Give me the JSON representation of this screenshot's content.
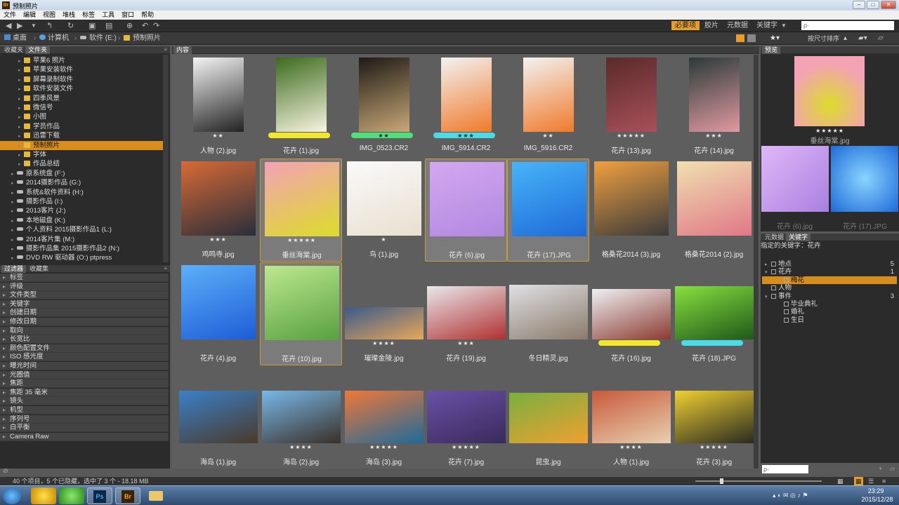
{
  "window": {
    "title": "预制照片"
  },
  "menu": [
    "文件",
    "编辑",
    "视图",
    "堆栈",
    "标签",
    "工具",
    "窗口",
    "帮助"
  ],
  "workspaces": {
    "active": "必要项",
    "items": [
      "胶片",
      "元数据",
      "关键字"
    ]
  },
  "search": {
    "placeholder": "ρ·"
  },
  "path": [
    "桌面",
    "计算机",
    "软件 (E:)",
    "预制照片"
  ],
  "sort": {
    "label": "按尺寸排序"
  },
  "panels": {
    "favorites": "收藏夹",
    "folders": "文件夹",
    "filter": "过滤器",
    "collections": "收藏集",
    "content": "内容",
    "preview": "预览",
    "metadata": "元数据",
    "keywords": "关键字"
  },
  "folders": [
    {
      "name": "苹果6 照片",
      "type": "folder",
      "indent": 1
    },
    {
      "name": "苹果安装软件",
      "type": "folder",
      "indent": 1
    },
    {
      "name": "屏幕录制软件",
      "type": "folder",
      "indent": 1
    },
    {
      "name": "软件安装文件",
      "type": "folder",
      "indent": 1
    },
    {
      "name": "四季风景",
      "type": "folder",
      "indent": 1
    },
    {
      "name": "微信号",
      "type": "folder",
      "indent": 1
    },
    {
      "name": "小图",
      "type": "folder",
      "indent": 1
    },
    {
      "name": "学员作品",
      "type": "folder",
      "indent": 1
    },
    {
      "name": "迅雷下载",
      "type": "folder",
      "indent": 1
    },
    {
      "name": "预制照片",
      "type": "folder",
      "indent": 1,
      "selected": true
    },
    {
      "name": "字体",
      "type": "folder",
      "indent": 1
    },
    {
      "name": "作品总结",
      "type": "folder",
      "indent": 1
    },
    {
      "name": "原系统盘 (F:)",
      "type": "drive",
      "indent": 0
    },
    {
      "name": "2014摄影作品 (G:)",
      "type": "drive",
      "indent": 0
    },
    {
      "name": "系统&软件资料 (H:)",
      "type": "drive",
      "indent": 0
    },
    {
      "name": "摄影作品 (I:)",
      "type": "drive",
      "indent": 0
    },
    {
      "name": "2013客片 (J:)",
      "type": "drive",
      "indent": 0
    },
    {
      "name": "本地磁盘 (K:)",
      "type": "drive",
      "indent": 0
    },
    {
      "name": "个人资料 2015摄影作品1 (L:)",
      "type": "drive",
      "indent": 0
    },
    {
      "name": "2014客片集 (M:)",
      "type": "drive",
      "indent": 0
    },
    {
      "name": "摄影作品集 2015摄影作品2 (N:)",
      "type": "drive",
      "indent": 0
    },
    {
      "name": "DVD RW 驱动器 (O:) ptpress",
      "type": "drive",
      "indent": 0
    }
  ],
  "filters": [
    "标签",
    "评级",
    "文件类型",
    "关键字",
    "创建日期",
    "修改日期",
    "取向",
    "长宽比",
    "颜色配置文件",
    "ISO 感光度",
    "曝光时间",
    "光圈值",
    "焦距",
    "焦距 35 毫米",
    "镜头",
    "机型",
    "序列号",
    "白平衡",
    "Camera Raw"
  ],
  "thumbnails": [
    {
      "name": "人物 (2).jpg",
      "stars": "★★",
      "row": 0,
      "col": 0,
      "w": 72,
      "h": 106,
      "colors": [
        "#f4f4f4",
        "#222"
      ]
    },
    {
      "name": "花卉 (1).jpg",
      "stars": "",
      "bar": "#f4e629",
      "row": 0,
      "col": 1,
      "w": 72,
      "h": 106,
      "colors": [
        "#3b6b1e",
        "#f8f4e0"
      ]
    },
    {
      "name": "IMG_0523.CR2",
      "stars": "★★",
      "bar": "#4ee07a",
      "row": 0,
      "col": 2,
      "w": 72,
      "h": 106,
      "colors": [
        "#1e1a15",
        "#c8a878"
      ]
    },
    {
      "name": "IMG_5914.CR2",
      "stars": "★★★",
      "bar": "#49dbe8",
      "row": 0,
      "col": 3,
      "w": 72,
      "h": 106,
      "colors": [
        "#f2f2f2",
        "#f07a2a"
      ]
    },
    {
      "name": "IMG_5916.CR2",
      "stars": "★★",
      "row": 0,
      "col": 4,
      "w": 72,
      "h": 106,
      "colors": [
        "#f2f2f2",
        "#f07a2a"
      ]
    },
    {
      "name": "花卉 (13).jpg",
      "stars": "★★★★★",
      "row": 0,
      "col": 5,
      "w": 72,
      "h": 106,
      "colors": [
        "#5a2a2a",
        "#a8505a"
      ]
    },
    {
      "name": "花卉 (14).jpg",
      "stars": "★★★",
      "row": 0,
      "col": 6,
      "w": 72,
      "h": 106,
      "colors": [
        "#2b3a3a",
        "#e09aa0"
      ]
    },
    {
      "name": "鸡鸣寺.jpg",
      "stars": "★★★",
      "row": 1,
      "col": 0,
      "w": 106,
      "h": 106,
      "colors": [
        "#d86a36",
        "#2a2e3a"
      ]
    },
    {
      "name": "垂丝海棠.jpg",
      "stars": "★★★★★",
      "row": 1,
      "col": 1,
      "w": 106,
      "h": 106,
      "colors": [
        "#f4a2b4",
        "#dcdc2a"
      ],
      "selected": true
    },
    {
      "name": "鸟 (1).jpg",
      "stars": "★",
      "row": 1,
      "col": 2,
      "w": 106,
      "h": 106,
      "colors": [
        "#fafafa",
        "#e8e0d0"
      ]
    },
    {
      "name": "花卉 (6).jpg",
      "stars": "",
      "row": 1,
      "col": 3,
      "w": 106,
      "h": 106,
      "colors": [
        "#d4a8f0",
        "#b088e0"
      ],
      "selected": true
    },
    {
      "name": "花卉 (17).JPG",
      "stars": "",
      "row": 1,
      "col": 4,
      "w": 106,
      "h": 106,
      "colors": [
        "#47b4f8",
        "#1e6ad8"
      ],
      "selected": true
    },
    {
      "name": "格桑花2014 (3).jpg",
      "stars": "",
      "row": 1,
      "col": 5,
      "w": 106,
      "h": 106,
      "colors": [
        "#f0a040",
        "#3a3a3a"
      ]
    },
    {
      "name": "格桑花2014 (2).jpg",
      "stars": "",
      "row": 1,
      "col": 6,
      "w": 106,
      "h": 106,
      "colors": [
        "#f0e0b0",
        "#e07888"
      ]
    },
    {
      "name": "花卉 (4).jpg",
      "stars": "",
      "row": 2,
      "col": 0,
      "w": 106,
      "h": 106,
      "colors": [
        "#5cb0f8",
        "#1e5cd8"
      ]
    },
    {
      "name": "花卉 (10).jpg",
      "stars": "",
      "row": 2,
      "col": 1,
      "w": 106,
      "h": 106,
      "colors": [
        "#bde890",
        "#58a040"
      ],
      "selected": true
    },
    {
      "name": "璀璨金陵.jpg",
      "stars": "★★★★",
      "row": 2,
      "col": 2,
      "w": 112,
      "h": 46,
      "colors": [
        "#3a5a8a",
        "#e8a85a"
      ]
    },
    {
      "name": "花卉 (19).jpg",
      "stars": "★★★",
      "row": 2,
      "col": 3,
      "w": 112,
      "h": 76,
      "colors": [
        "#e8e8ec",
        "#b03030"
      ]
    },
    {
      "name": "冬日精灵.jpg",
      "stars": "",
      "row": 2,
      "col": 4,
      "w": 112,
      "h": 78,
      "colors": [
        "#e0e0e4",
        "#8a7a6a"
      ]
    },
    {
      "name": "花卉 (16).jpg",
      "stars": "",
      "bar": "#f4e629",
      "row": 2,
      "col": 5,
      "w": 112,
      "h": 72,
      "colors": [
        "#f0f0f4",
        "#8a3a30"
      ]
    },
    {
      "name": "花卉 (18).JPG",
      "stars": "",
      "bar": "#49dbe8",
      "row": 2,
      "col": 6,
      "w": 112,
      "h": 76,
      "colors": [
        "#88e040",
        "#1e5818"
      ]
    },
    {
      "name": "海岛 (1).jpg",
      "stars": "",
      "row": 3,
      "col": 0,
      "w": 112,
      "h": 75,
      "colors": [
        "#3a80c8",
        "#4a3a2a"
      ]
    },
    {
      "name": "海岛 (2).jpg",
      "stars": "★★★★",
      "row": 3,
      "col": 1,
      "w": 112,
      "h": 75,
      "colors": [
        "#78b8e8",
        "#3a3028"
      ]
    },
    {
      "name": "海岛 (3).jpg",
      "stars": "★★★★★",
      "row": 3,
      "col": 2,
      "w": 112,
      "h": 75,
      "colors": [
        "#f07838",
        "#1e6a9a"
      ]
    },
    {
      "name": "花卉 (7).jpg",
      "stars": "★★★★★",
      "row": 3,
      "col": 3,
      "w": 112,
      "h": 75,
      "colors": [
        "#6a50a8",
        "#3a2a5a"
      ]
    },
    {
      "name": "昆虫.jpg",
      "stars": "",
      "row": 3,
      "col": 4,
      "w": 112,
      "h": 72,
      "colors": [
        "#78b040",
        "#f0a030"
      ]
    },
    {
      "name": "人物 (1).jpg",
      "stars": "★★★★",
      "row": 3,
      "col": 5,
      "w": 112,
      "h": 75,
      "colors": [
        "#c85a3a",
        "#e8d0b0"
      ]
    },
    {
      "name": "花卉 (3).jpg",
      "stars": "★★★★★",
      "row": 3,
      "col": 6,
      "w": 112,
      "h": 75,
      "colors": [
        "#f0d030",
        "#2a2a20"
      ]
    }
  ],
  "preview": {
    "name": "垂丝海棠.jpg",
    "stars": "★★★★★",
    "extra": [
      "花卉 (6).jpg",
      "花卉 (17).JPG"
    ]
  },
  "keywords_panel": {
    "assigned_label": "指定的关键字：",
    "assigned": "花卉",
    "items": [
      {
        "name": "地点",
        "count": "5",
        "level": 0,
        "expand": "▸"
      },
      {
        "name": "花卉",
        "count": "1",
        "level": 0,
        "expand": "▾"
      },
      {
        "name": "梅花",
        "count": "",
        "level": 1,
        "expand": "",
        "selected": true
      },
      {
        "name": "人物",
        "count": "",
        "level": 0,
        "expand": ""
      },
      {
        "name": "事件",
        "count": "3",
        "level": 0,
        "expand": "▾"
      },
      {
        "name": "毕业典礼",
        "count": "",
        "level": 1,
        "expand": ""
      },
      {
        "name": "婚礼",
        "count": "",
        "level": 1,
        "expand": ""
      },
      {
        "name": "生日",
        "count": "",
        "level": 1,
        "expand": ""
      }
    ]
  },
  "status": {
    "text": "40 个项目，5 个已隐藏，选中了 3 个 - 18.18 MB"
  },
  "taskbar": {
    "time": "23:29",
    "date": "2015/12/28"
  },
  "colors": {
    "accent": "#e79d2b",
    "label_yellow": "#f4e629",
    "label_green": "#4ee07a",
    "label_cyan": "#49dbe8"
  }
}
